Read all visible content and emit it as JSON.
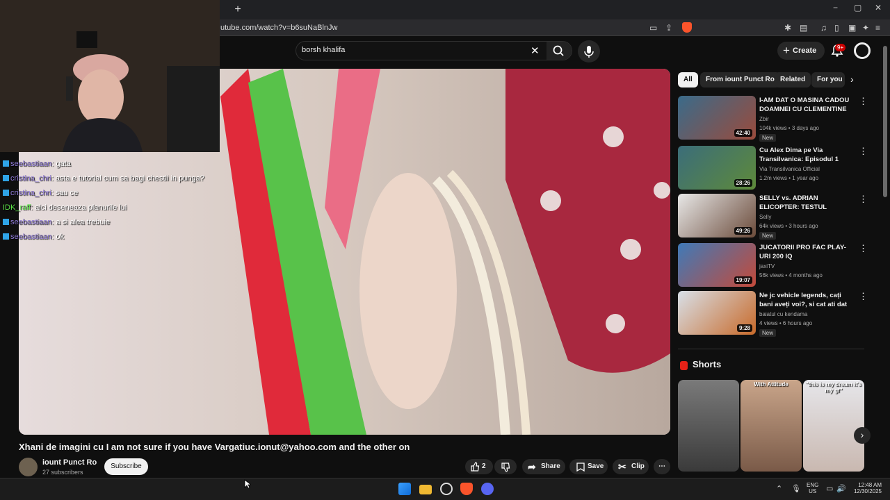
{
  "browser": {
    "new_tab": "+",
    "url": "utube.com/watch?v=b6suNaBlnJw",
    "window_controls": [
      "−",
      "▢",
      "✕"
    ]
  },
  "header": {
    "search_query": "borsh khalifa",
    "create_label": "Create",
    "notification_count": "9+"
  },
  "overlay_chat": [
    {
      "user": "seebastiaan",
      "message": "gata",
      "user_color": "purple"
    },
    {
      "user": "cristina_chri",
      "message": "asta e tutorial cum sa bagi chestii in punga?",
      "user_color": "purple"
    },
    {
      "user": "cristina_chri",
      "message": "sau ce",
      "user_color": "purple"
    },
    {
      "user": "IDK_raff",
      "message": "aici deseneaza planurile lui",
      "user_color": "green"
    },
    {
      "user": "seebastiaan",
      "message": "a si alea trebuie",
      "user_color": "purple"
    },
    {
      "user": "seebastiaan",
      "message": "ok",
      "user_color": "purple"
    }
  ],
  "video": {
    "title": "Xhani de imagini cu I am not sure if you have Vargatiuc.ionut@yahoo.com and the other on",
    "channel": "iount Punct Ro",
    "subscribers": "27 subscribers",
    "subscribe_label": "Subscribe",
    "likes": "2",
    "share_label": "Share",
    "save_label": "Save",
    "clip_label": "Clip"
  },
  "chips": [
    "All",
    "From iount Punct Ro",
    "Related",
    "For you"
  ],
  "recommendations": [
    {
      "title": "I-AM DAT O MASINA CADOU DOAMNEI CU CLEMENTINE D...",
      "channel": "Zbir",
      "meta": "104k views • 3 days ago",
      "duration": "42:40",
      "badge": "New",
      "colors": [
        "#3a6b8a",
        "#9a4b3c"
      ]
    },
    {
      "title": "Cu Alex Dima pe Via Transilvanica: Episodul 1",
      "channel": "Via Transilvanica Official",
      "meta": "1.2m views • 1 year ago",
      "duration": "28:26",
      "badge": "",
      "colors": [
        "#3b6d7a",
        "#5e8a3a"
      ]
    },
    {
      "title": "SELLY vs. ADRIAN ELICOPTER: TESTUL POLIGRAF (Detectoru...",
      "channel": "Selly",
      "meta": "64k views • 3 hours ago",
      "duration": "49:26",
      "badge": "New",
      "colors": [
        "#e8e8e8",
        "#6b4b3a"
      ]
    },
    {
      "title": "JUCATORII PRO FAC PLAY-URI 200 IQ",
      "channel": "jaxiTV",
      "meta": "56k views • 4 months ago",
      "duration": "19:07",
      "badge": "",
      "colors": [
        "#3f7ab8",
        "#c44a3a"
      ]
    },
    {
      "title": "Ne jc vehicle legends, cați bani aveți voi?, si cat ati dat pe ...",
      "channel": "baiatul cu kendama",
      "meta": "4 views • 6 hours ago",
      "duration": "9:28",
      "badge": "New",
      "colors": [
        "#d8e0e8",
        "#c86a2a"
      ]
    }
  ],
  "shorts": {
    "heading": "Shorts",
    "items": [
      {
        "caption": "",
        "colors": [
          "#7a7a7a",
          "#3a3a3a"
        ]
      },
      {
        "caption": "With Attitude",
        "colors": [
          "#c9a58a",
          "#7a5a48"
        ]
      },
      {
        "caption": "\"this is my dream it's my gf\"",
        "colors": [
          "#e6e6ea",
          "#c9b8b0"
        ]
      }
    ]
  },
  "taskbar": {
    "lang": "ENG",
    "region": "US",
    "time": "12:48 AM",
    "date": "12/30/2025"
  }
}
